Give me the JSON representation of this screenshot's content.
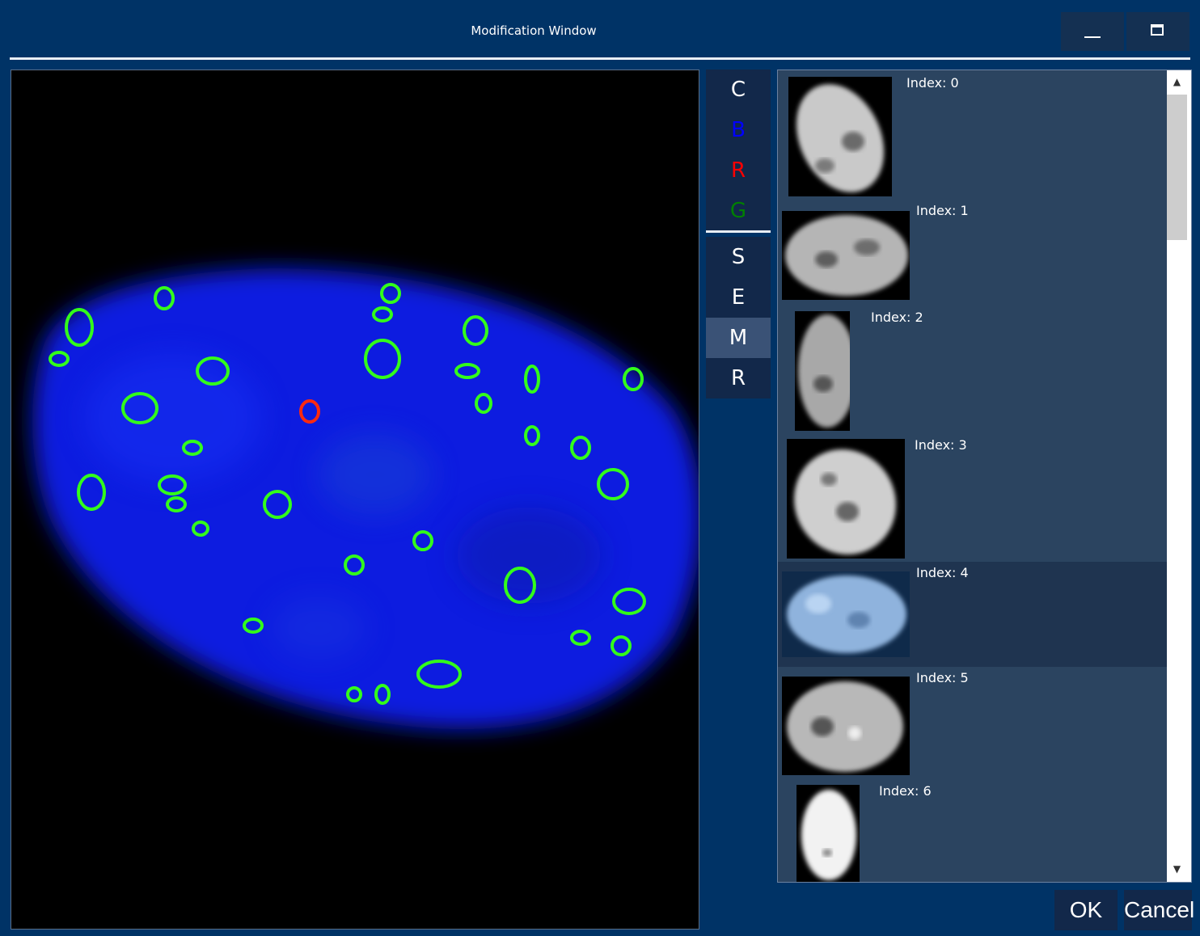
{
  "window": {
    "title": "Modification Window",
    "minimize_icon": "minimize-icon",
    "maximize_icon": "maximize-icon"
  },
  "toolbar": {
    "channels": [
      {
        "label": "C",
        "color": "#ffffff"
      },
      {
        "label": "B",
        "color": "#0000ff"
      },
      {
        "label": "R",
        "color": "#ff0000"
      },
      {
        "label": "G",
        "color": "#008000"
      }
    ],
    "modes": [
      {
        "label": "S",
        "selected": false
      },
      {
        "label": "E",
        "selected": false
      },
      {
        "label": "M",
        "selected": true
      },
      {
        "label": "R",
        "selected": false
      }
    ]
  },
  "nuclei": [
    {
      "label": "Index: 0"
    },
    {
      "label": "Index: 1"
    },
    {
      "label": "Index: 2"
    },
    {
      "label": "Index: 3"
    },
    {
      "label": "Index: 4",
      "selected": true
    },
    {
      "label": "Index: 5"
    },
    {
      "label": "Index: 6"
    }
  ],
  "actions": {
    "ok": "OK",
    "cancel": "Cancel"
  },
  "colors": {
    "background": "#003366",
    "nucleus": "#0a1fe0",
    "spot_marker": "#33ff1a",
    "selected_marker": "#ff2a10"
  }
}
